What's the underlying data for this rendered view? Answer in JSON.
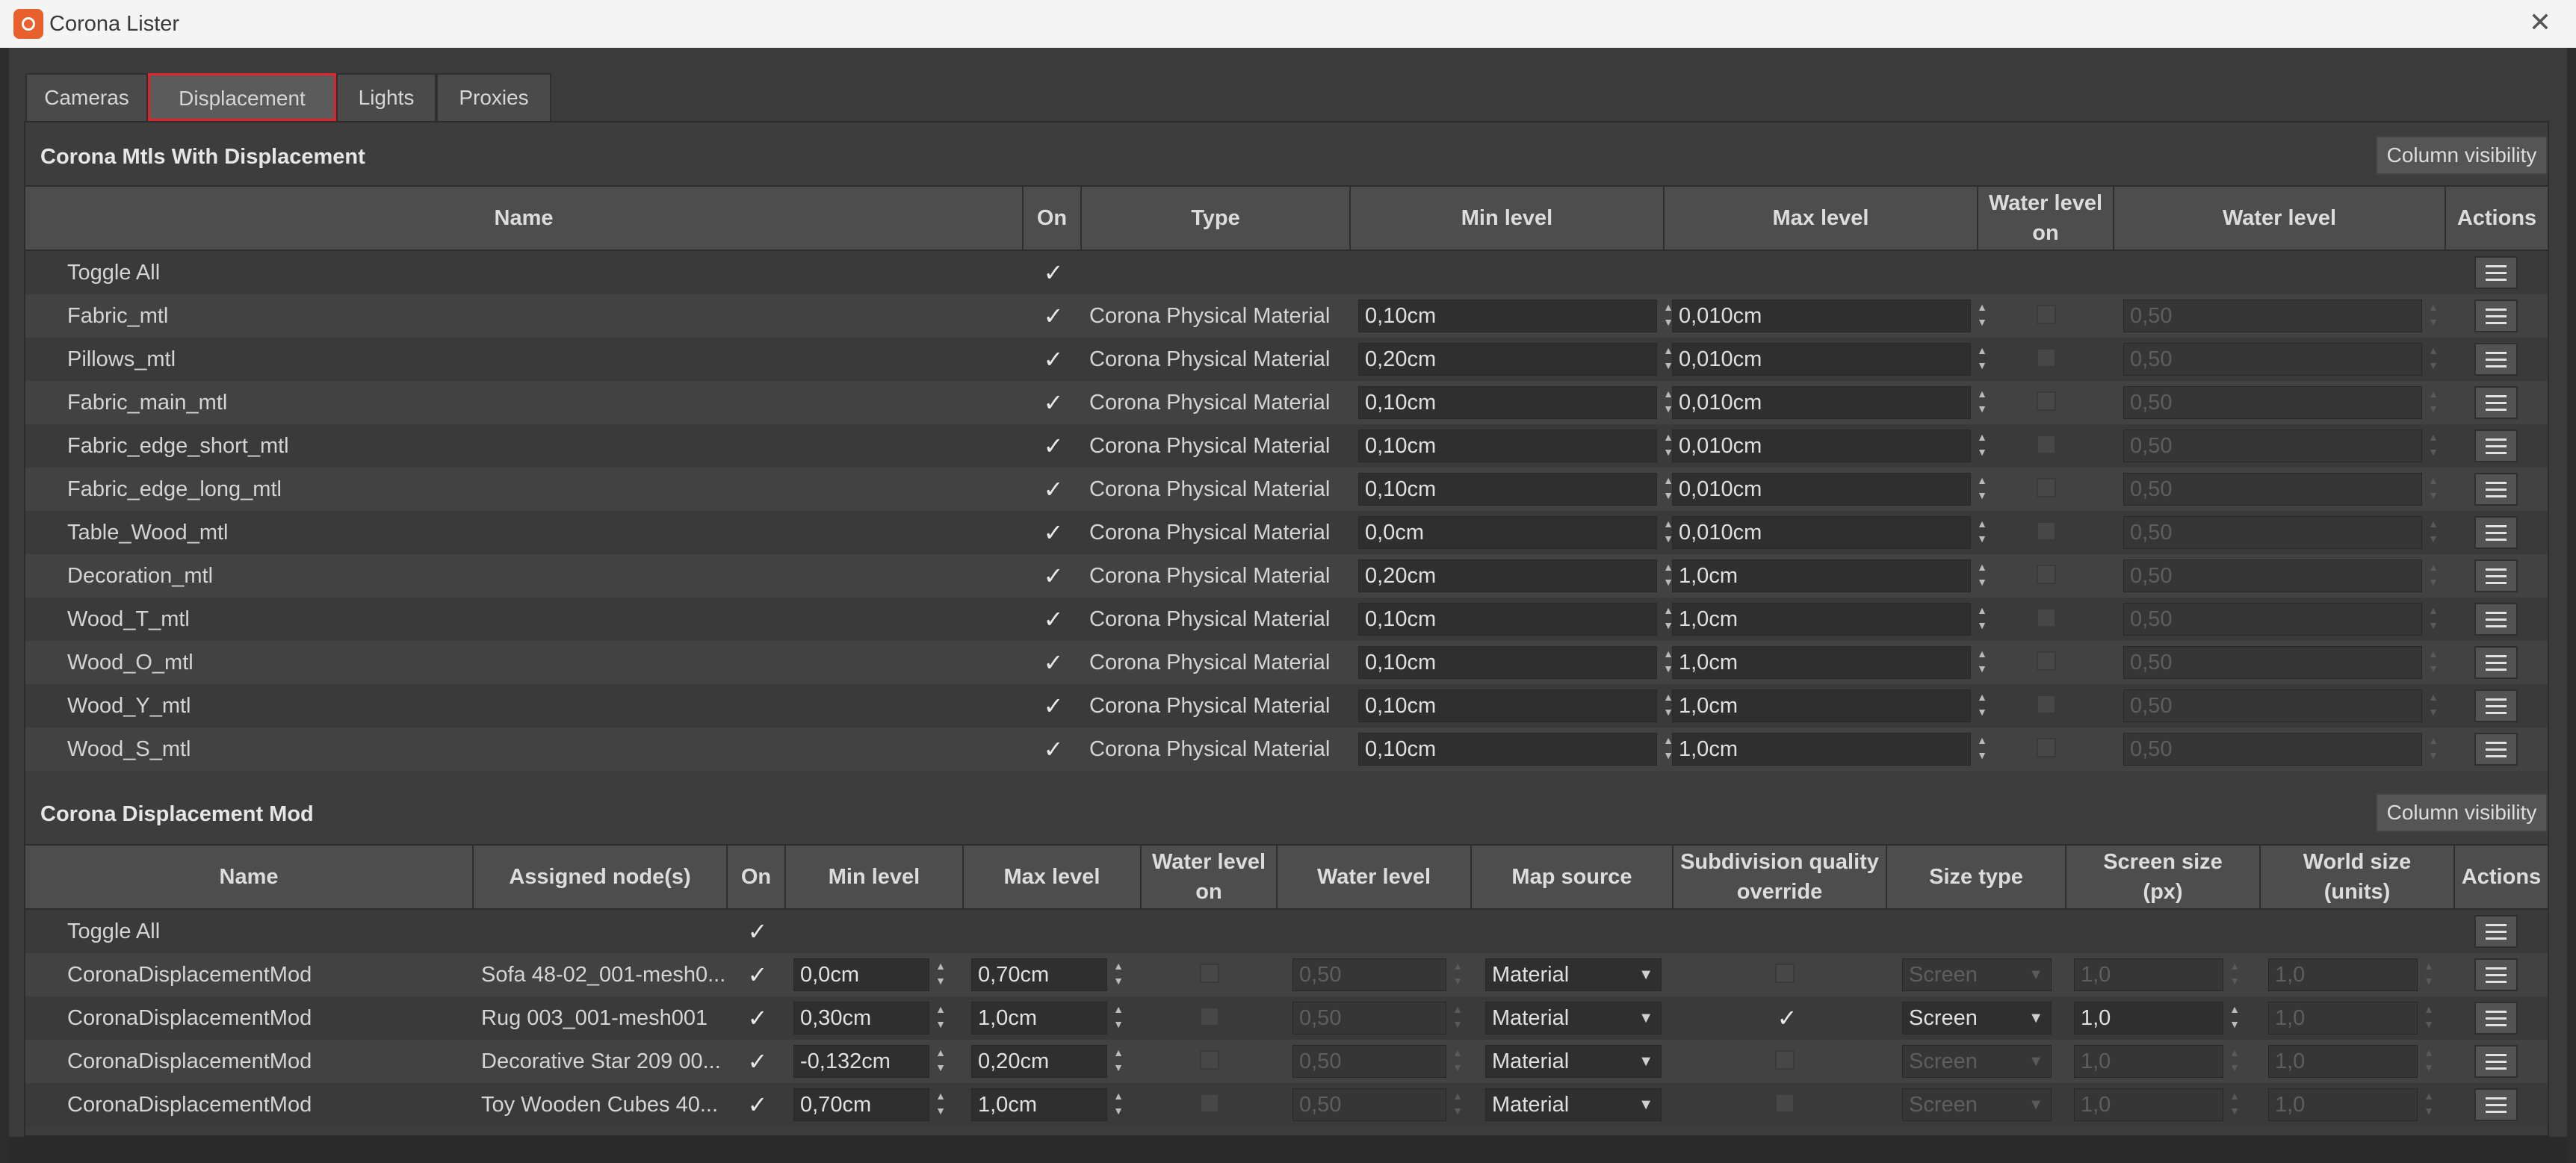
{
  "window": {
    "title": "Corona Lister",
    "icon": "corona-logo-icon",
    "close_icon": "close-icon"
  },
  "tabs": [
    {
      "label": "Cameras"
    },
    {
      "label": "Displacement",
      "active": true
    },
    {
      "label": "Lights"
    },
    {
      "label": "Proxies"
    }
  ],
  "colors": {
    "active_tab_outline": "#e0252a",
    "background": "#3b3b3b",
    "header": "#4d4d4d"
  },
  "mtls": {
    "title": "Corona Mtls With Displacement",
    "column_visibility": "Column visibility",
    "headers": {
      "name": "Name",
      "on": "On",
      "type": "Type",
      "min": "Min level",
      "max": "Max level",
      "wlon": "Water level on",
      "wl": "Water level",
      "actions": "Actions"
    },
    "toggle_all": "Toggle All",
    "rows": [
      {
        "name": "Fabric_mtl",
        "type": "Corona Physical Material",
        "min": "0,10cm",
        "max": "0,010cm",
        "wl": "0,50"
      },
      {
        "name": "Pillows_mtl",
        "type": "Corona Physical Material",
        "min": "0,20cm",
        "max": "0,010cm",
        "wl": "0,50"
      },
      {
        "name": "Fabric_main_mtl",
        "type": "Corona Physical Material",
        "min": "0,10cm",
        "max": "0,010cm",
        "wl": "0,50"
      },
      {
        "name": "Fabric_edge_short_mtl",
        "type": "Corona Physical Material",
        "min": "0,10cm",
        "max": "0,010cm",
        "wl": "0,50"
      },
      {
        "name": "Fabric_edge_long_mtl",
        "type": "Corona Physical Material",
        "min": "0,10cm",
        "max": "0,010cm",
        "wl": "0,50"
      },
      {
        "name": "Table_Wood_mtl",
        "type": "Corona Physical Material",
        "min": "0,0cm",
        "max": "0,010cm",
        "wl": "0,50"
      },
      {
        "name": "Decoration_mtl",
        "type": "Corona Physical Material",
        "min": "0,20cm",
        "max": "1,0cm",
        "wl": "0,50"
      },
      {
        "name": "Wood_T_mtl",
        "type": "Corona Physical Material",
        "min": "0,10cm",
        "max": "1,0cm",
        "wl": "0,50"
      },
      {
        "name": "Wood_O_mtl",
        "type": "Corona Physical Material",
        "min": "0,10cm",
        "max": "1,0cm",
        "wl": "0,50"
      },
      {
        "name": "Wood_Y_mtl",
        "type": "Corona Physical Material",
        "min": "0,10cm",
        "max": "1,0cm",
        "wl": "0,50"
      },
      {
        "name": "Wood_S_mtl",
        "type": "Corona Physical Material",
        "min": "0,10cm",
        "max": "1,0cm",
        "wl": "0,50"
      }
    ]
  },
  "mods": {
    "title": "Corona Displacement Mod",
    "column_visibility": "Column visibility",
    "headers": {
      "name": "Name",
      "nodes": "Assigned node(s)",
      "on": "On",
      "min": "Min level",
      "max": "Max level",
      "wlon": "Water level on",
      "wl": "Water level",
      "map": "Map source",
      "subdiv": "Subdivision quality override",
      "size": "Size type",
      "screen": "Screen size (px)",
      "world": "World size (units)",
      "actions": "Actions"
    },
    "toggle_all": "Toggle All",
    "rows": [
      {
        "name": "CoronaDisplacementMod",
        "nodes": "Sofa 48-02_001-mesh0...",
        "min": "0,0cm",
        "max": "0,70cm",
        "wl": "0,50",
        "map": "Material",
        "subdiv": false,
        "size": "Screen",
        "screen": "1,0",
        "world": "1,0"
      },
      {
        "name": "CoronaDisplacementMod",
        "nodes": "Rug 003_001-mesh001",
        "min": "0,30cm",
        "max": "1,0cm",
        "wl": "0,50",
        "map": "Material",
        "subdiv": true,
        "size": "Screen",
        "screen": "1,0",
        "world": "1,0"
      },
      {
        "name": "CoronaDisplacementMod",
        "nodes": "Decorative Star 209 00...",
        "min": "-0,132cm",
        "max": "0,20cm",
        "wl": "0,50",
        "map": "Material",
        "subdiv": false,
        "size": "Screen",
        "screen": "1,0",
        "world": "1,0"
      },
      {
        "name": "CoronaDisplacementMod",
        "nodes": "Toy Wooden Cubes 40...",
        "min": "0,70cm",
        "max": "1,0cm",
        "wl": "0,50",
        "map": "Material",
        "subdiv": false,
        "size": "Screen",
        "screen": "1,0",
        "world": "1,0"
      }
    ]
  }
}
